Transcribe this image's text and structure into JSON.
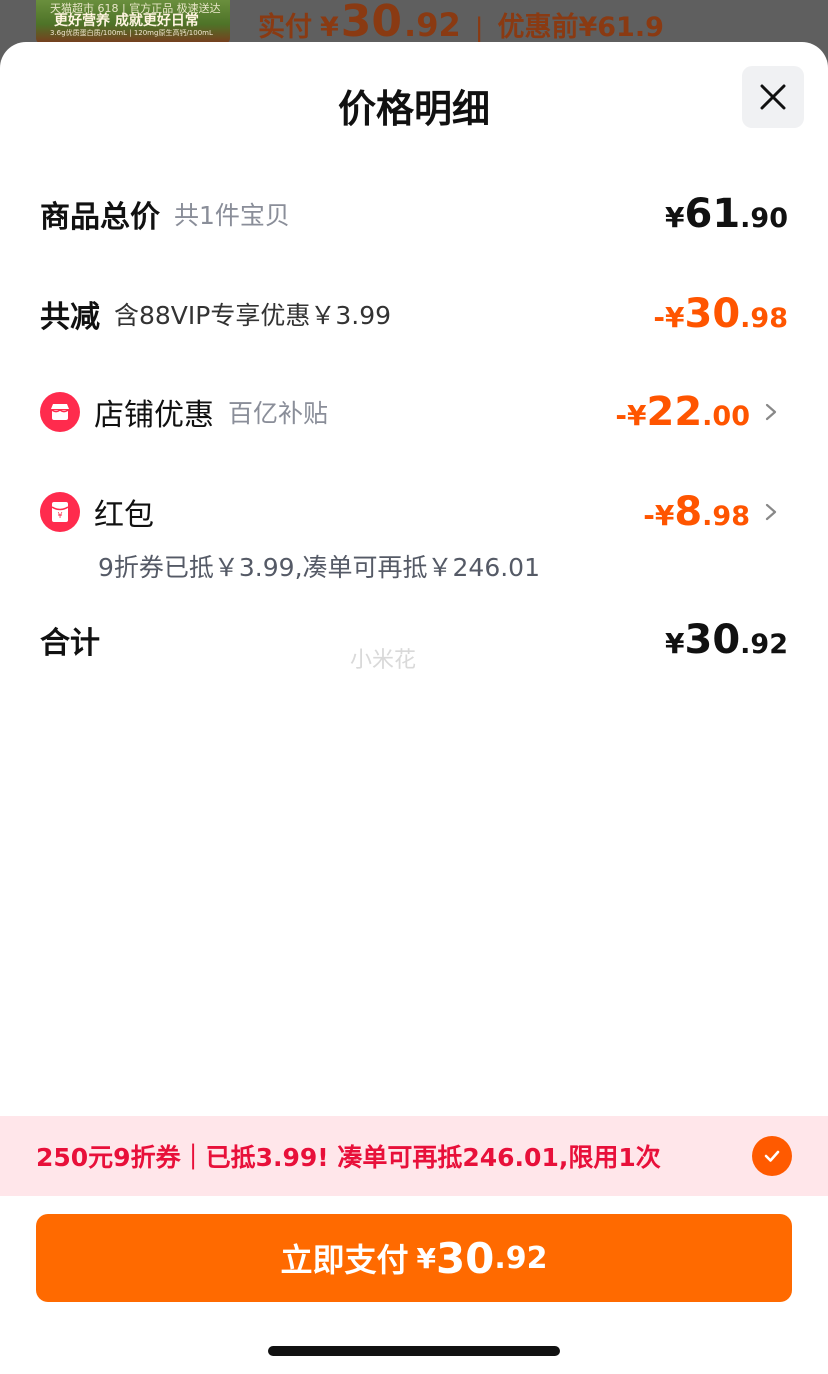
{
  "background": {
    "promo_line1": "天猫超市 618 | 官方正品 极速送达",
    "promo_line2": "更好营养 成就更好日常",
    "promo_line3": "3.6g优质蛋白质/100mL | 120mg原生高钙/100mL",
    "paid_label": "实付",
    "paid_currency": "¥",
    "paid_int": "30",
    "paid_dec": ".92",
    "separator": "|",
    "before_discount": "优惠前¥61.9"
  },
  "sheet": {
    "title": "价格明细",
    "close_icon": "close-icon"
  },
  "rows": {
    "total": {
      "title": "商品总价",
      "sub": "共1件宝贝",
      "currency": "¥",
      "int": "61",
      "dec": ".90"
    },
    "reduction": {
      "title": "共减",
      "sub": "含88VIP专享优惠￥3.99",
      "currency": "-¥",
      "int": "30",
      "dec": ".98"
    },
    "shop_discount": {
      "title": "店铺优惠",
      "sub": "百亿补贴",
      "currency": "-¥",
      "int": "22",
      "dec": ".00"
    },
    "red_packet": {
      "title": "红包",
      "hint": "9折券已抵￥3.99,凑单可再抵￥246.01",
      "currency": "-¥",
      "int": "8",
      "dec": ".98"
    },
    "sum": {
      "title": "合计",
      "currency": "¥",
      "int": "30",
      "dec": ".92"
    }
  },
  "watermark": "小米花",
  "coupon": {
    "text": "250元9折券｜已抵3.99! 凑单可再抵246.01,限用1次",
    "checked": true
  },
  "pay_button": {
    "label": "立即支付",
    "currency": "¥",
    "int": "30",
    "dec": ".92"
  },
  "colors": {
    "accent_orange": "#ff6a00",
    "discount_orange": "#ff5500",
    "coupon_red": "#e8103a",
    "coupon_bg": "#ffe6ea",
    "icon_red": "#ff2b4d"
  }
}
